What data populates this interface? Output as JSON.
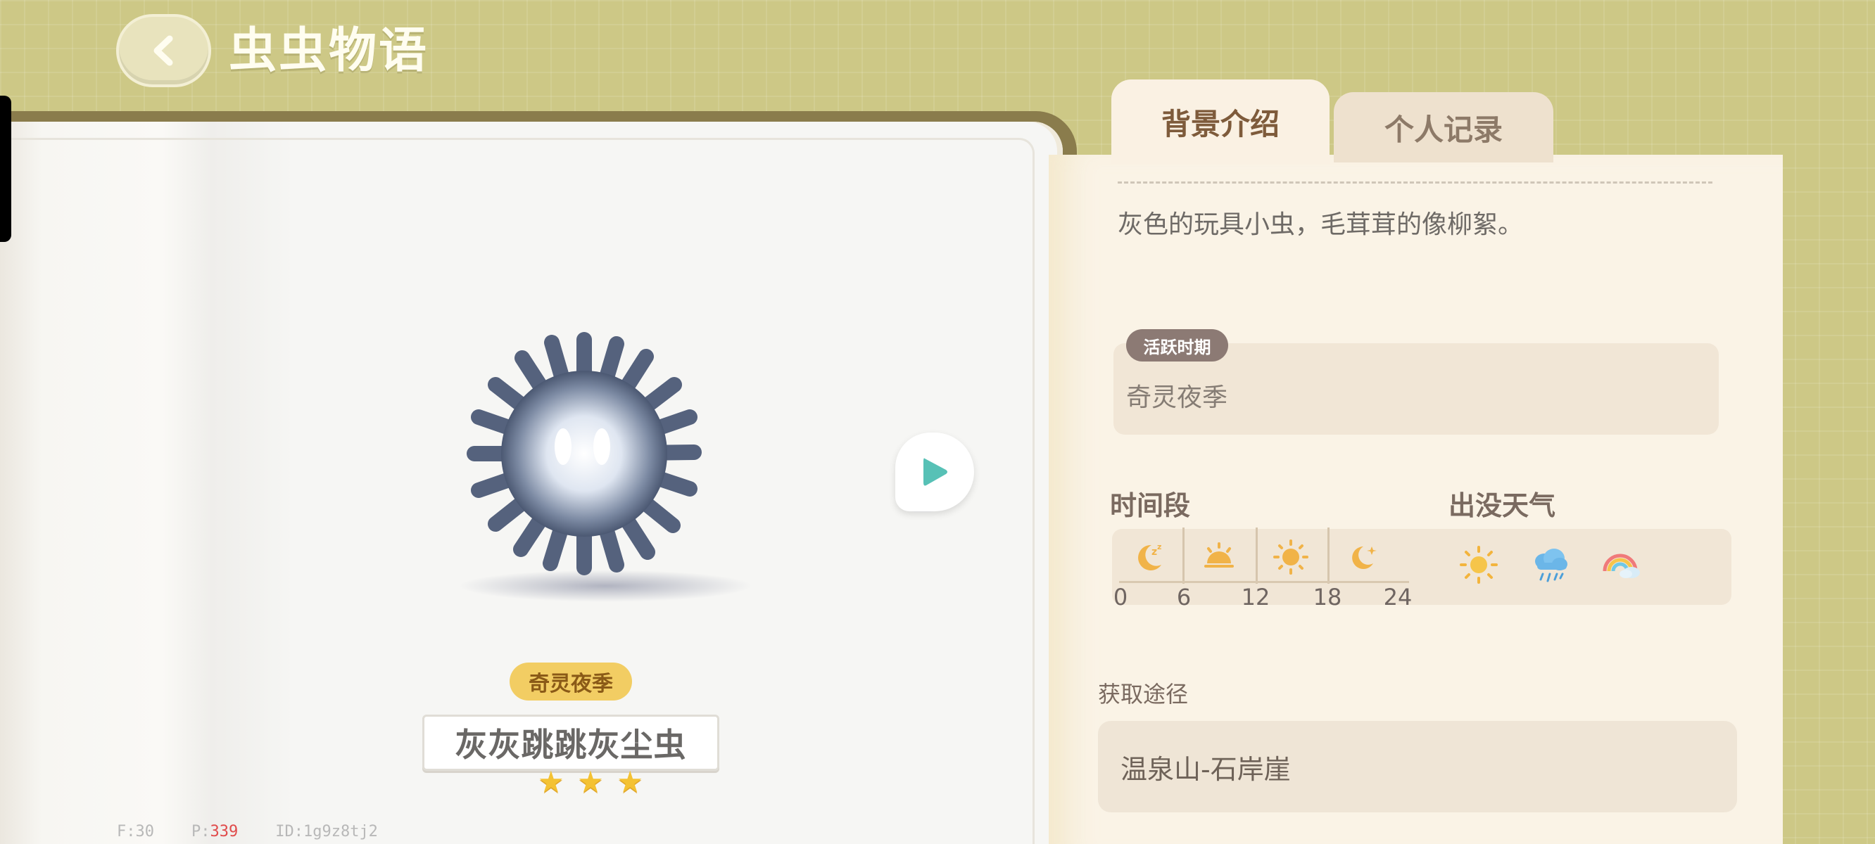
{
  "header": {
    "title": "虫虫物语",
    "back_icon": "chevron-left-icon"
  },
  "tabs": [
    {
      "label": "背景介绍",
      "active": true
    },
    {
      "label": "个人记录",
      "active": false
    }
  ],
  "bug": {
    "season_tag": "奇灵夜季",
    "name": "灰灰跳跳灰尘虫",
    "rarity_stars": 3,
    "star_glyphs": [
      "★",
      "★",
      "★"
    ]
  },
  "detail": {
    "description": "灰色的玩具小虫，毛茸茸的像柳絮。",
    "active_period": {
      "label": "活跃时期",
      "value": "奇灵夜季"
    },
    "time_section": {
      "label": "时间段",
      "slots": [
        "night-moon-sleep-icon",
        "sunrise-icon",
        "sun-icon",
        "moon-star-icon"
      ],
      "ticks": [
        "0",
        "6",
        "12",
        "18",
        "24"
      ]
    },
    "weather_section": {
      "label": "出没天气",
      "items": [
        "sunny-icon",
        "rain-icon",
        "rainbow-icon"
      ]
    },
    "source": {
      "label": "获取途径",
      "value": "温泉山-石岸崖"
    }
  },
  "debug": {
    "f_label": "F:",
    "f_value": "30",
    "p_label": "P:",
    "p_value": "339",
    "id_label": "ID:",
    "id_value": "1g9z8tj2"
  },
  "colors": {
    "background": "#cdc886",
    "season_tag": "#f2cd63",
    "active_tag": "#8c7a74",
    "next_arrow": "#57c1b6",
    "star": "#f4c233",
    "panel": "#faf3e6"
  }
}
